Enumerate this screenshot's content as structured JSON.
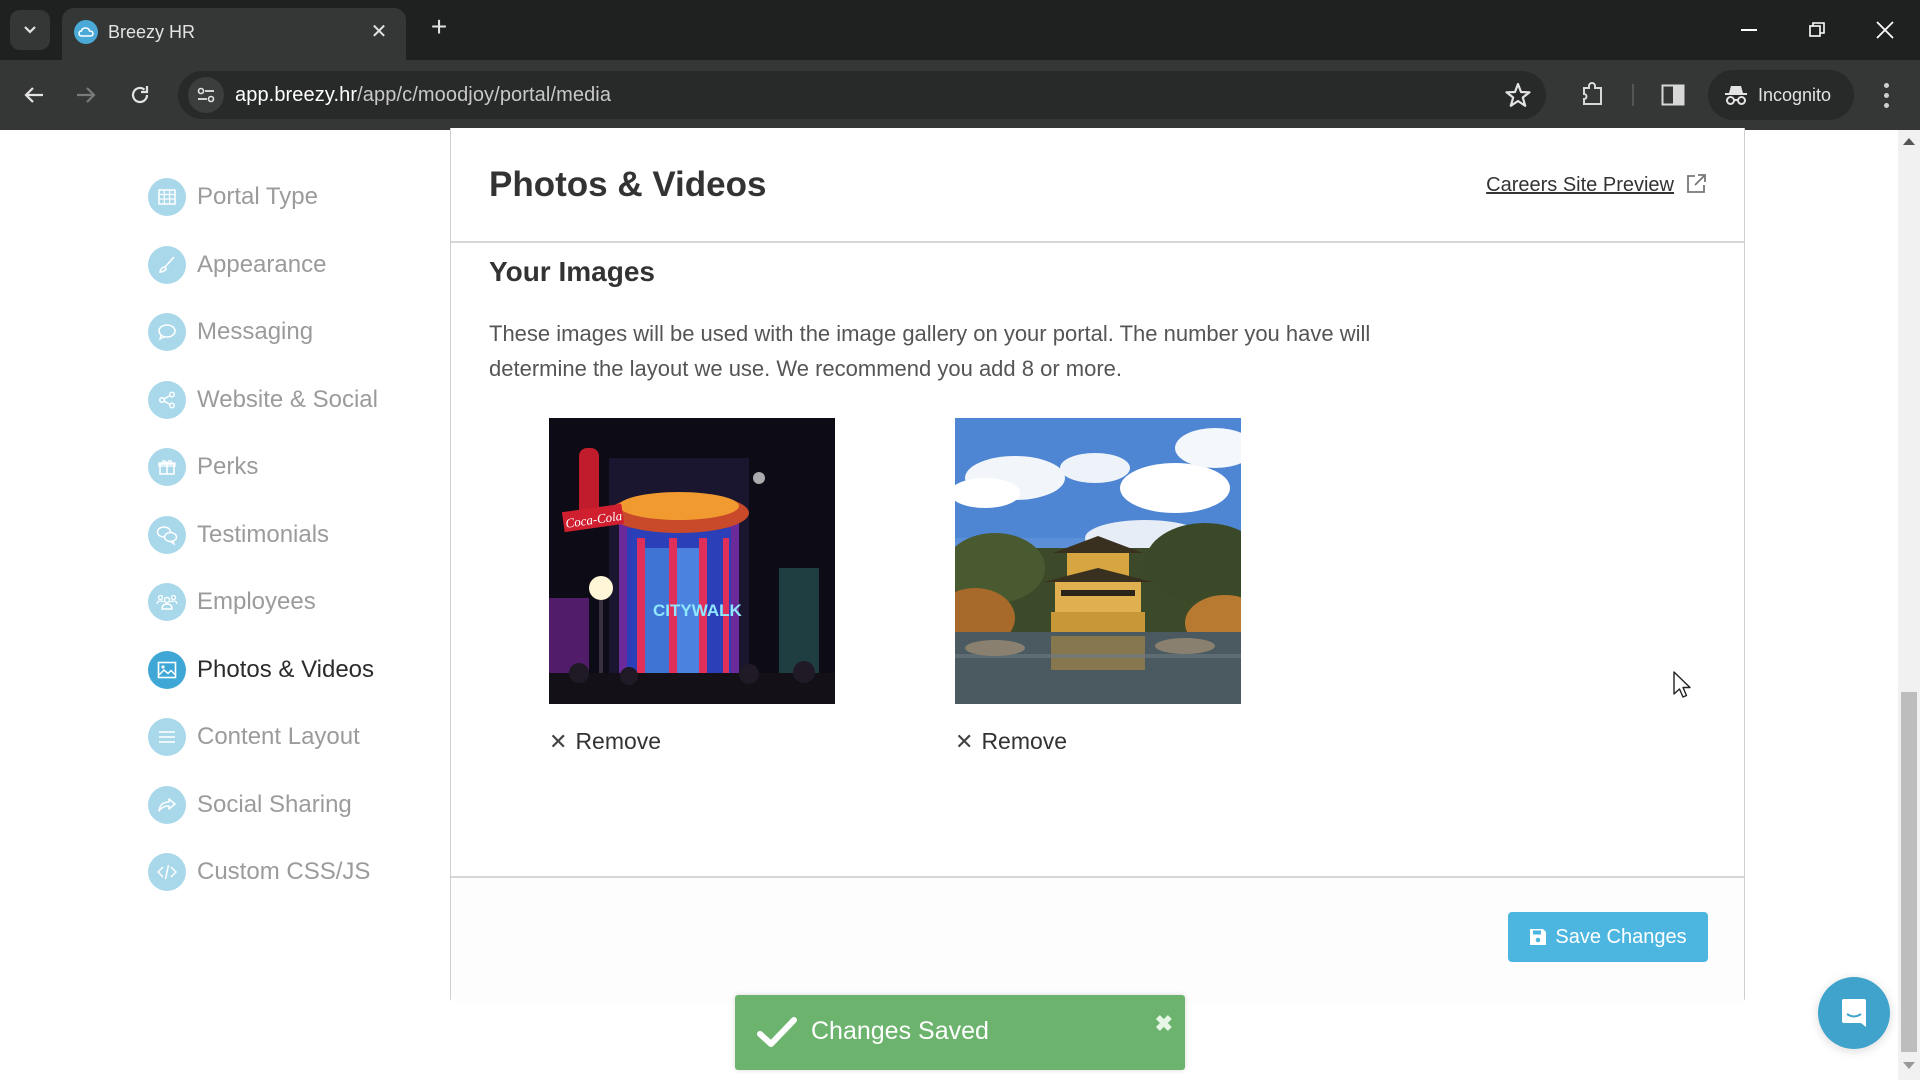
{
  "browser": {
    "tab_title": "Breezy HR",
    "url_host": "app.breezy.hr",
    "url_path": "/app/c/moodjoy/portal/media",
    "profile_label": "Incognito"
  },
  "sidebar": {
    "items": [
      {
        "label": "Portal Type",
        "icon": "grid-icon",
        "active": false
      },
      {
        "label": "Appearance",
        "icon": "brush-icon",
        "active": false
      },
      {
        "label": "Messaging",
        "icon": "speech-bubble-icon",
        "active": false
      },
      {
        "label": "Website & Social",
        "icon": "share-icon",
        "active": false
      },
      {
        "label": "Perks",
        "icon": "gift-icon",
        "active": false
      },
      {
        "label": "Testimonials",
        "icon": "chat-bubbles-icon",
        "active": false
      },
      {
        "label": "Employees",
        "icon": "people-icon",
        "active": false
      },
      {
        "label": "Photos & Videos",
        "icon": "image-icon",
        "active": true
      },
      {
        "label": "Content Layout",
        "icon": "lines-icon",
        "active": false
      },
      {
        "label": "Social Sharing",
        "icon": "share-arrow-icon",
        "active": false
      },
      {
        "label": "Custom CSS/JS",
        "icon": "code-icon",
        "active": false
      }
    ]
  },
  "panel": {
    "title": "Photos & Videos",
    "preview_link": "Careers Site Preview",
    "section_title": "Your Images",
    "section_description": "These images will be used with the image gallery on your portal. The number you have will determine the layout we use. We recommend you add 8 or more.",
    "images": [
      {
        "alt": "CityWalk neon storefront at night",
        "remove_label": "Remove"
      },
      {
        "alt": "Golden pavilion temple by a pond",
        "remove_label": "Remove"
      }
    ],
    "save_label": "Save Changes"
  },
  "toast": {
    "message": "Changes Saved",
    "close_glyph": "✖"
  },
  "colors": {
    "accent": "#4db6e0",
    "sidebar_icon_inactive": "#a9d8ea",
    "sidebar_icon_active": "#3fa7d6",
    "toast_success": "#6cb46e"
  }
}
